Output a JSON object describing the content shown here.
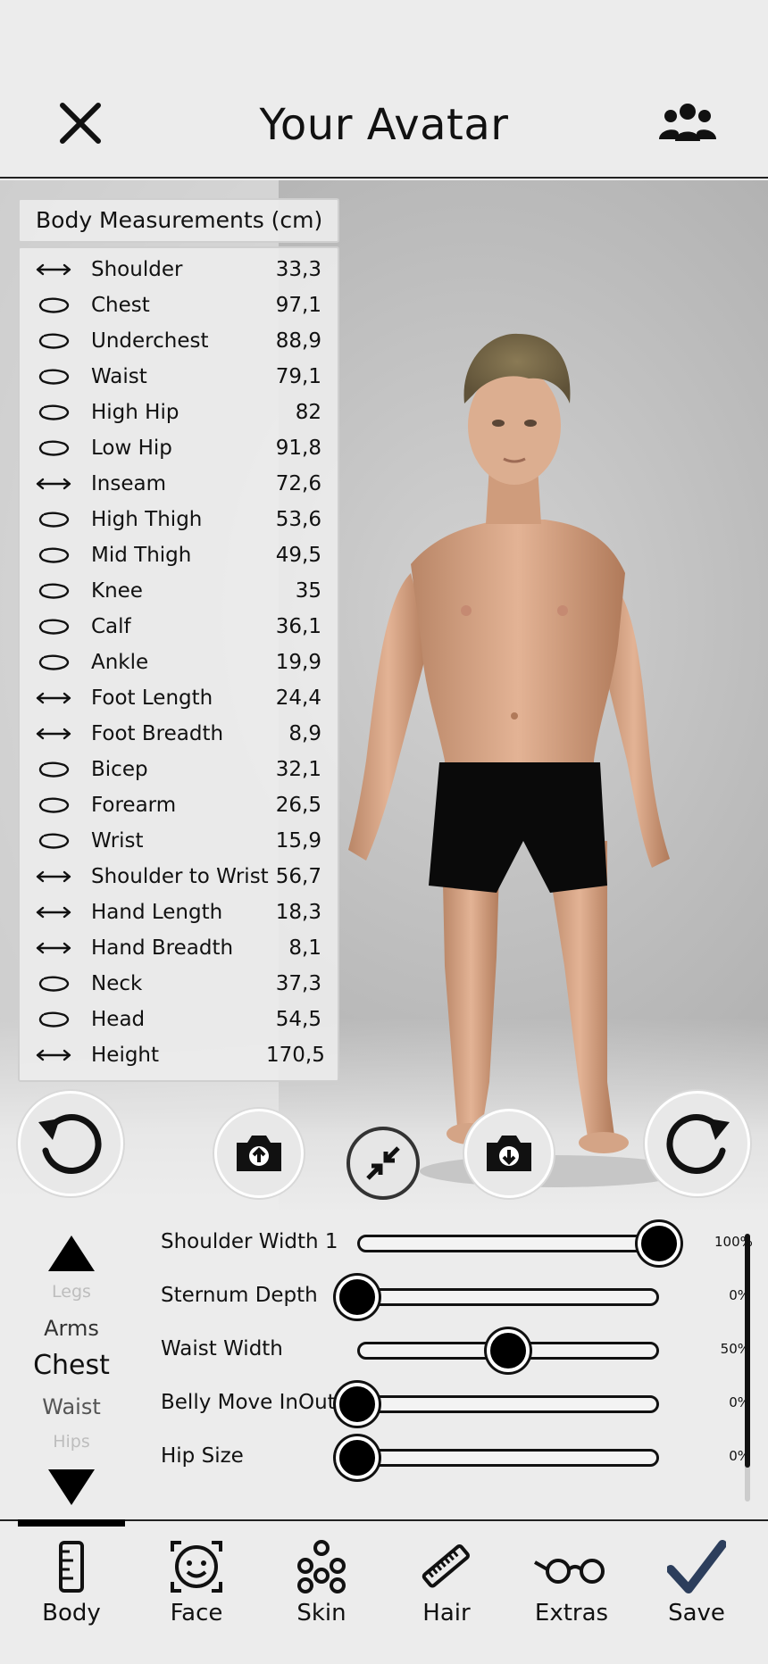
{
  "header": {
    "title": "Your Avatar",
    "close_icon": "close-icon",
    "people_icon": "group-icon"
  },
  "measurements": {
    "title": "Body Measurements (cm)",
    "rows": [
      {
        "label": "Shoulder",
        "value": "33,3",
        "type": "length"
      },
      {
        "label": "Chest",
        "value": "97,1",
        "type": "circumference"
      },
      {
        "label": "Underchest",
        "value": "88,9",
        "type": "circumference"
      },
      {
        "label": "Waist",
        "value": "79,1",
        "type": "circumference"
      },
      {
        "label": "High Hip",
        "value": "82",
        "type": "circumference"
      },
      {
        "label": "Low Hip",
        "value": "91,8",
        "type": "circumference"
      },
      {
        "label": "Inseam",
        "value": "72,6",
        "type": "length"
      },
      {
        "label": "High Thigh",
        "value": "53,6",
        "type": "circumference"
      },
      {
        "label": "Mid Thigh",
        "value": "49,5",
        "type": "circumference"
      },
      {
        "label": "Knee",
        "value": "35",
        "type": "circumference"
      },
      {
        "label": "Calf",
        "value": "36,1",
        "type": "circumference"
      },
      {
        "label": "Ankle",
        "value": "19,9",
        "type": "circumference"
      },
      {
        "label": "Foot Length",
        "value": "24,4",
        "type": "length"
      },
      {
        "label": "Foot Breadth",
        "value": "8,9",
        "type": "length"
      },
      {
        "label": "Bicep",
        "value": "32,1",
        "type": "circumference"
      },
      {
        "label": "Forearm",
        "value": "26,5",
        "type": "circumference"
      },
      {
        "label": "Wrist",
        "value": "15,9",
        "type": "circumference"
      },
      {
        "label": "Shoulder to Wrist",
        "value": "56,7",
        "type": "length"
      },
      {
        "label": "Hand Length",
        "value": "18,3",
        "type": "length"
      },
      {
        "label": "Hand Breadth",
        "value": "8,1",
        "type": "length"
      },
      {
        "label": "Neck",
        "value": "37,3",
        "type": "circumference"
      },
      {
        "label": "Head",
        "value": "54,5",
        "type": "circumference"
      },
      {
        "label": "Height",
        "value": "170,5",
        "type": "length"
      }
    ]
  },
  "viewport_buttons": {
    "undo_icon": "undo-icon",
    "upload_icon": "camera-upload-icon",
    "collapse_icon": "collapse-arrows-icon",
    "download_icon": "camera-download-icon",
    "redo_icon": "redo-icon"
  },
  "categories": {
    "items": [
      "Legs",
      "Arms",
      "Chest",
      "Waist",
      "Hips"
    ],
    "selected": "Chest"
  },
  "sliders": [
    {
      "label": "Shoulder Width 1",
      "percent": "100%",
      "value": 1.0
    },
    {
      "label": "Sternum Depth",
      "percent": "0%",
      "value": 0.0
    },
    {
      "label": "Waist Width",
      "percent": "50%",
      "value": 0.5
    },
    {
      "label": "Belly Move InOut",
      "percent": "0%",
      "value": 0.0
    },
    {
      "label": "Hip Size",
      "percent": "0%",
      "value": 0.0
    }
  ],
  "nav": {
    "selected": "Body",
    "items": [
      {
        "label": "Body",
        "icon": "ruler-icon"
      },
      {
        "label": "Face",
        "icon": "face-icon"
      },
      {
        "label": "Skin",
        "icon": "skin-icon"
      },
      {
        "label": "Hair",
        "icon": "comb-icon"
      },
      {
        "label": "Extras",
        "icon": "glasses-icon"
      },
      {
        "label": "Save",
        "icon": "checkmark-icon"
      }
    ]
  },
  "colors": {
    "background": "#ececec",
    "accent": "#2c3e5c",
    "text": "#111111"
  }
}
